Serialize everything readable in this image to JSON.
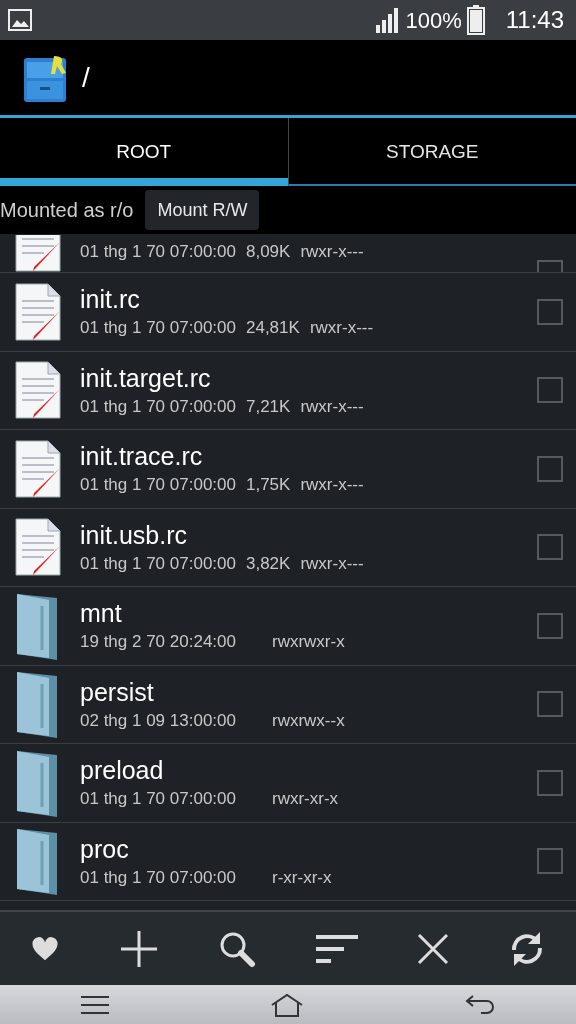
{
  "status_bar": {
    "battery": "100%",
    "time": "11:43"
  },
  "action_bar": {
    "title": "/"
  },
  "tabs": [
    {
      "label": "ROOT",
      "selected": true
    },
    {
      "label": "STORAGE",
      "selected": false
    }
  ],
  "mount": {
    "label": "Mounted as r/o",
    "button": "Mount R/W"
  },
  "files": [
    {
      "kind": "file",
      "partial": true,
      "date": "01 thg 1 70 07:00:00",
      "size": "8,09K",
      "perms": "rwxr-x---",
      "checked": false
    },
    {
      "kind": "file",
      "name": "init.rc",
      "date": "01 thg 1 70 07:00:00",
      "size": "24,81K",
      "perms": "rwxr-x---",
      "checked": false
    },
    {
      "kind": "file",
      "name": "init.target.rc",
      "date": "01 thg 1 70 07:00:00",
      "size": "7,21K",
      "perms": "rwxr-x---",
      "checked": false
    },
    {
      "kind": "file",
      "name": "init.trace.rc",
      "date": "01 thg 1 70 07:00:00",
      "size": "1,75K",
      "perms": "rwxr-x---",
      "checked": false
    },
    {
      "kind": "file",
      "name": "init.usb.rc",
      "date": "01 thg 1 70 07:00:00",
      "size": "3,82K",
      "perms": "rwxr-x---",
      "checked": false
    },
    {
      "kind": "folder",
      "name": "mnt",
      "date": "19 thg 2 70 20:24:00",
      "perms": "rwxrwxr-x",
      "checked": false
    },
    {
      "kind": "folder",
      "name": "persist",
      "date": "02 thg 1 09 13:00:00",
      "perms": "rwxrwx--x",
      "checked": false
    },
    {
      "kind": "folder",
      "name": "preload",
      "date": "01 thg 1 70 07:00:00",
      "perms": "rwxr-xr-x",
      "checked": false
    },
    {
      "kind": "folder",
      "name": "proc",
      "date": "01 thg 1 70 07:00:00",
      "perms": "r-xr-xr-x",
      "checked": false
    }
  ]
}
